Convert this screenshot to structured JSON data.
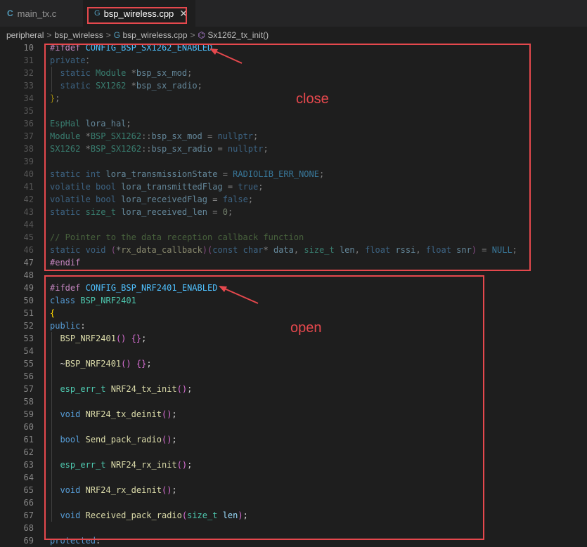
{
  "tabs": [
    {
      "icon": "C",
      "label": "main_tx.c"
    },
    {
      "icon": "G",
      "label": "bsp_wireless.cpp",
      "close": "✕"
    }
  ],
  "breadcrumb": {
    "items": [
      "peripheral",
      "bsp_wireless",
      "bsp_wireless.cpp",
      "Sx1262_tx_init()"
    ],
    "separator": ">",
    "file_icon": "G",
    "function_icon": "⌬"
  },
  "annotations": {
    "close_label": "close",
    "open_label": "open"
  },
  "colors": {
    "annotation_red": "#e5484d",
    "editor_bg": "#1e1e1e"
  },
  "code_lines": [
    {
      "n": "10",
      "dim": false,
      "t": [
        [
          "pp",
          "#ifdef "
        ],
        [
          "ma",
          "CONFIG_BSP_SX1262_ENABLED"
        ]
      ]
    },
    {
      "n": "31",
      "dim": true,
      "t": [
        [
          "kw",
          "private"
        ],
        [
          "",
          "："
        ]
      ]
    },
    {
      "n": "32",
      "dim": true,
      "t": [
        [
          "",
          "  "
        ],
        [
          "kw",
          "static"
        ],
        [
          "",
          " "
        ],
        [
          "ty",
          "Module"
        ],
        [
          "",
          " *"
        ],
        [
          "var",
          "bsp_sx_mod"
        ],
        [
          "",
          ";"
        ]
      ]
    },
    {
      "n": "33",
      "dim": true,
      "t": [
        [
          "",
          "  "
        ],
        [
          "kw",
          "static"
        ],
        [
          "",
          " "
        ],
        [
          "ty",
          "SX1262"
        ],
        [
          "",
          " *"
        ],
        [
          "var",
          "bsp_sx_radio"
        ],
        [
          "",
          ";"
        ]
      ]
    },
    {
      "n": "34",
      "dim": true,
      "t": [
        [
          "br",
          "}"
        ],
        [
          "",
          ";"
        ]
      ]
    },
    {
      "n": "35",
      "dim": true,
      "t": []
    },
    {
      "n": "36",
      "dim": true,
      "t": [
        [
          "ty",
          "EspHal"
        ],
        [
          "",
          " "
        ],
        [
          "var",
          "lora_hal"
        ],
        [
          "",
          ";"
        ]
      ]
    },
    {
      "n": "37",
      "dim": true,
      "t": [
        [
          "ty",
          "Module"
        ],
        [
          "",
          " *"
        ],
        [
          "ty",
          "BSP_SX1262"
        ],
        [
          "",
          "::"
        ],
        [
          "var",
          "bsp_sx_mod"
        ],
        [
          "",
          " = "
        ],
        [
          "kw",
          "nullptr"
        ],
        [
          "",
          ";"
        ]
      ]
    },
    {
      "n": "38",
      "dim": true,
      "t": [
        [
          "ty",
          "SX1262"
        ],
        [
          "",
          " *"
        ],
        [
          "ty",
          "BSP_SX1262"
        ],
        [
          "",
          "::"
        ],
        [
          "var",
          "bsp_sx_radio"
        ],
        [
          "",
          " = "
        ],
        [
          "kw",
          "nullptr"
        ],
        [
          "",
          ";"
        ]
      ]
    },
    {
      "n": "39",
      "dim": true,
      "t": []
    },
    {
      "n": "40",
      "dim": true,
      "t": [
        [
          "kw",
          "static"
        ],
        [
          "",
          " "
        ],
        [
          "kw",
          "int"
        ],
        [
          "",
          " "
        ],
        [
          "var",
          "lora_transmissionState"
        ],
        [
          "",
          " = "
        ],
        [
          "ma",
          "RADIOLIB_ERR_NONE"
        ],
        [
          "",
          ";"
        ]
      ]
    },
    {
      "n": "41",
      "dim": true,
      "t": [
        [
          "kw",
          "volatile"
        ],
        [
          "",
          " "
        ],
        [
          "kw",
          "bool"
        ],
        [
          "",
          " "
        ],
        [
          "var",
          "lora_transmittedFlag"
        ],
        [
          "",
          " = "
        ],
        [
          "kw",
          "true"
        ],
        [
          "",
          ";"
        ]
      ]
    },
    {
      "n": "42",
      "dim": true,
      "t": [
        [
          "kw",
          "volatile"
        ],
        [
          "",
          " "
        ],
        [
          "kw",
          "bool"
        ],
        [
          "",
          " "
        ],
        [
          "var",
          "lora_receivedFlag"
        ],
        [
          "",
          " = "
        ],
        [
          "kw",
          "false"
        ],
        [
          "",
          ";"
        ]
      ]
    },
    {
      "n": "43",
      "dim": true,
      "t": [
        [
          "kw",
          "static"
        ],
        [
          "",
          " "
        ],
        [
          "ty",
          "size_t"
        ],
        [
          "",
          " "
        ],
        [
          "var",
          "lora_received_len"
        ],
        [
          "",
          " = "
        ],
        [
          "num",
          "0"
        ],
        [
          "",
          ";"
        ]
      ]
    },
    {
      "n": "44",
      "dim": true,
      "t": []
    },
    {
      "n": "45",
      "dim": true,
      "t": [
        [
          "cm",
          "// Pointer to the data reception callback function"
        ]
      ]
    },
    {
      "n": "46",
      "dim": true,
      "t": [
        [
          "kw",
          "static"
        ],
        [
          "",
          " "
        ],
        [
          "kw",
          "void"
        ],
        [
          "",
          " "
        ],
        [
          "bp",
          "("
        ],
        [
          "",
          "*"
        ],
        [
          "fn",
          "rx_data_callback"
        ],
        [
          "bp",
          ")"
        ],
        [
          "bp",
          "("
        ],
        [
          "kw",
          "const"
        ],
        [
          "",
          " "
        ],
        [
          "kw",
          "char"
        ],
        [
          "",
          "* "
        ],
        [
          "var",
          "data"
        ],
        [
          "",
          ", "
        ],
        [
          "ty",
          "size_t"
        ],
        [
          "",
          " "
        ],
        [
          "var",
          "len"
        ],
        [
          "",
          ", "
        ],
        [
          "kw",
          "float"
        ],
        [
          "",
          " "
        ],
        [
          "var",
          "rssi"
        ],
        [
          "",
          ", "
        ],
        [
          "kw",
          "float"
        ],
        [
          "",
          " "
        ],
        [
          "var",
          "snr"
        ],
        [
          "bp",
          ")"
        ],
        [
          "",
          " = "
        ],
        [
          "ma",
          "NULL"
        ],
        [
          "",
          ";"
        ]
      ]
    },
    {
      "n": "47",
      "dim": false,
      "t": [
        [
          "pp",
          "#endif"
        ]
      ]
    },
    {
      "n": "48",
      "dim": false,
      "t": []
    },
    {
      "n": "49",
      "dim": false,
      "t": [
        [
          "pp",
          "#ifdef "
        ],
        [
          "ma",
          "CONFIG_BSP_NRF2401_ENABLED"
        ]
      ]
    },
    {
      "n": "50",
      "dim": false,
      "t": [
        [
          "kw",
          "class"
        ],
        [
          "",
          " "
        ],
        [
          "ty",
          "BSP_NRF2401"
        ]
      ]
    },
    {
      "n": "51",
      "dim": false,
      "t": [
        [
          "br",
          "{"
        ]
      ]
    },
    {
      "n": "52",
      "dim": false,
      "t": [
        [
          "kw",
          "public"
        ],
        [
          "",
          ":"
        ]
      ]
    },
    {
      "n": "53",
      "dim": false,
      "t": [
        [
          "",
          "  "
        ],
        [
          "fn",
          "BSP_NRF2401"
        ],
        [
          "bp",
          "()"
        ],
        [
          "",
          " "
        ],
        [
          "bp",
          "{}"
        ],
        [
          "",
          ";"
        ]
      ]
    },
    {
      "n": "54",
      "dim": false,
      "t": []
    },
    {
      "n": "55",
      "dim": false,
      "t": [
        [
          "",
          "  ~"
        ],
        [
          "fn",
          "BSP_NRF2401"
        ],
        [
          "bp",
          "()"
        ],
        [
          "",
          " "
        ],
        [
          "bp",
          "{}"
        ],
        [
          "",
          ";"
        ]
      ]
    },
    {
      "n": "56",
      "dim": false,
      "t": []
    },
    {
      "n": "57",
      "dim": false,
      "t": [
        [
          "",
          "  "
        ],
        [
          "ty",
          "esp_err_t"
        ],
        [
          "",
          " "
        ],
        [
          "fn",
          "NRF24_tx_init"
        ],
        [
          "bp",
          "()"
        ],
        [
          "",
          ";"
        ]
      ]
    },
    {
      "n": "58",
      "dim": false,
      "t": []
    },
    {
      "n": "59",
      "dim": false,
      "t": [
        [
          "",
          "  "
        ],
        [
          "kw",
          "void"
        ],
        [
          "",
          " "
        ],
        [
          "fn",
          "NRF24_tx_deinit"
        ],
        [
          "bp",
          "()"
        ],
        [
          "",
          ";"
        ]
      ]
    },
    {
      "n": "60",
      "dim": false,
      "t": []
    },
    {
      "n": "61",
      "dim": false,
      "t": [
        [
          "",
          "  "
        ],
        [
          "kw",
          "bool"
        ],
        [
          "",
          " "
        ],
        [
          "fn",
          "Send_pack_radio"
        ],
        [
          "bp",
          "()"
        ],
        [
          "",
          ";"
        ]
      ]
    },
    {
      "n": "62",
      "dim": false,
      "t": []
    },
    {
      "n": "63",
      "dim": false,
      "t": [
        [
          "",
          "  "
        ],
        [
          "ty",
          "esp_err_t"
        ],
        [
          "",
          " "
        ],
        [
          "fn",
          "NRF24_rx_init"
        ],
        [
          "bp",
          "()"
        ],
        [
          "",
          ";"
        ]
      ]
    },
    {
      "n": "64",
      "dim": false,
      "t": []
    },
    {
      "n": "65",
      "dim": false,
      "t": [
        [
          "",
          "  "
        ],
        [
          "kw",
          "void"
        ],
        [
          "",
          " "
        ],
        [
          "fn",
          "NRF24_rx_deinit"
        ],
        [
          "bp",
          "()"
        ],
        [
          "",
          ";"
        ]
      ]
    },
    {
      "n": "66",
      "dim": false,
      "t": []
    },
    {
      "n": "67",
      "dim": false,
      "t": [
        [
          "",
          "  "
        ],
        [
          "kw",
          "void"
        ],
        [
          "",
          " "
        ],
        [
          "fn",
          "Received_pack_radio"
        ],
        [
          "bp",
          "("
        ],
        [
          "ty",
          "size_t"
        ],
        [
          "",
          " "
        ],
        [
          "var",
          "len"
        ],
        [
          "bp",
          ")"
        ],
        [
          "",
          ";"
        ]
      ]
    },
    {
      "n": "68",
      "dim": false,
      "t": []
    },
    {
      "n": "69",
      "dim": false,
      "t": [
        [
          "kw",
          "protected"
        ],
        [
          "",
          ":"
        ]
      ]
    }
  ]
}
